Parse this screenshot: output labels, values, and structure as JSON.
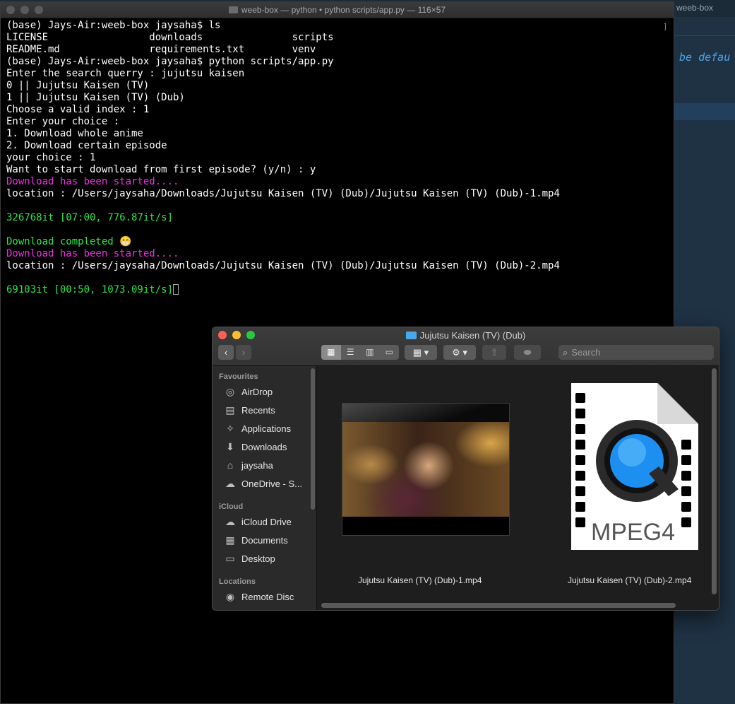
{
  "background_editor": {
    "tab_label": "weeb-box",
    "code_fragment": "be defau"
  },
  "terminal": {
    "title": "weeb-box — python • python scripts/app.py — 116×57",
    "lines": [
      {
        "text": "(base) Jays-Air:weeb-box jaysaha$ ls",
        "color": "white"
      },
      {
        "text": "LICENSE                 downloads               scripts",
        "color": "white"
      },
      {
        "text": "README.md               requirements.txt        venv",
        "color": "white"
      },
      {
        "text": "(base) Jays-Air:weeb-box jaysaha$ python scripts/app.py",
        "color": "white"
      },
      {
        "text": "Enter the search querry : jujutsu kaisen",
        "color": "white"
      },
      {
        "text": "0 || Jujutsu Kaisen (TV)",
        "color": "white"
      },
      {
        "text": "1 || Jujutsu Kaisen (TV) (Dub)",
        "color": "white"
      },
      {
        "text": "Choose a valid index : 1",
        "color": "white"
      },
      {
        "text": "Enter your choice :",
        "color": "white"
      },
      {
        "text": "1. Download whole anime",
        "color": "white"
      },
      {
        "text": "2. Download certain episode",
        "color": "white"
      },
      {
        "text": "your choice : 1",
        "color": "white"
      },
      {
        "text": "Want to start download from first episode? (y/n) : y",
        "color": "white"
      },
      {
        "text": "Download has been started....",
        "color": "magenta"
      },
      {
        "text": "location : /Users/jaysaha/Downloads/Jujutsu Kaisen (TV) (Dub)/Jujutsu Kaisen (TV) (Dub)-1.mp4",
        "color": "white"
      },
      {
        "text": "",
        "color": "white"
      },
      {
        "text": "326768it [07:00, 776.87it/s]",
        "color": "green"
      },
      {
        "text": "",
        "color": "white"
      },
      {
        "text": "Download completed 😁",
        "color": "green"
      },
      {
        "text": "Download has been started....",
        "color": "magenta"
      },
      {
        "text": "location : /Users/jaysaha/Downloads/Jujutsu Kaisen (TV) (Dub)/Jujutsu Kaisen (TV) (Dub)-2.mp4",
        "color": "white"
      },
      {
        "text": "",
        "color": "white"
      },
      {
        "text": "69103it [00:50, 1073.09it/s]",
        "color": "green",
        "cursor": true
      }
    ]
  },
  "finder": {
    "title": "Jujutsu Kaisen (TV) (Dub)",
    "search_placeholder": "Search",
    "sidebar": {
      "favourites_heading": "Favourites",
      "favourites": [
        {
          "label": "AirDrop",
          "icon": "airdrop-icon",
          "glyph": "◎"
        },
        {
          "label": "Recents",
          "icon": "recents-icon",
          "glyph": "▤"
        },
        {
          "label": "Applications",
          "icon": "applications-icon",
          "glyph": "✧"
        },
        {
          "label": "Downloads",
          "icon": "downloads-icon",
          "glyph": "⬇"
        },
        {
          "label": "jaysaha",
          "icon": "home-icon",
          "glyph": "⌂"
        },
        {
          "label": "OneDrive - S...",
          "icon": "cloud-icon",
          "glyph": "☁"
        }
      ],
      "icloud_heading": "iCloud",
      "icloud": [
        {
          "label": "iCloud Drive",
          "icon": "icloud-icon",
          "glyph": "☁"
        },
        {
          "label": "Documents",
          "icon": "documents-icon",
          "glyph": "▦"
        },
        {
          "label": "Desktop",
          "icon": "desktop-icon",
          "glyph": "▭"
        }
      ],
      "locations_heading": "Locations",
      "locations": [
        {
          "label": "Remote Disc",
          "icon": "disc-icon",
          "glyph": "◉"
        }
      ]
    },
    "files": [
      {
        "name": "Jujutsu Kaisen (TV) (Dub)-1.mp4",
        "kind": "video-thumbnail"
      },
      {
        "name": "Jujutsu Kaisen (TV) (Dub)-2.mp4",
        "kind": "mpeg4-document",
        "badge": "MPEG4"
      }
    ]
  }
}
